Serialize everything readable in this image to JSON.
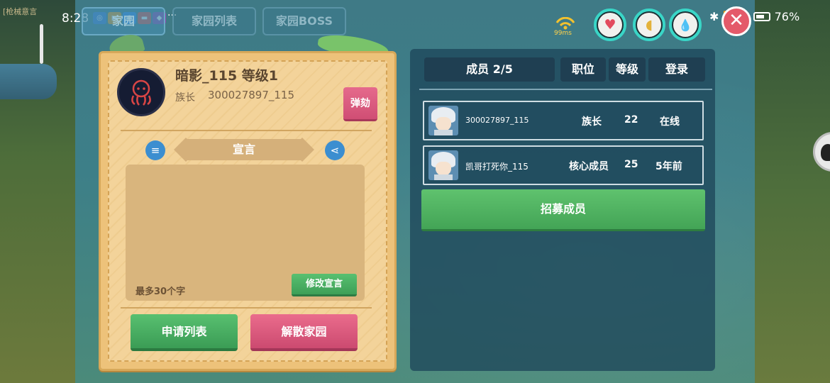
{
  "status_bar": {
    "time": "8:28",
    "more": "···",
    "battery": "76%"
  },
  "background": {
    "left_label": "[枪械意言"
  },
  "tabs": [
    {
      "label": "家园",
      "active": true
    },
    {
      "label": "家园列表",
      "active": false
    },
    {
      "label": "家园BOSS",
      "active": false
    }
  ],
  "hud": {
    "ping": "99ms",
    "gauges": [
      {
        "icon": "heart-icon",
        "glyph": "♥",
        "color": "#e24b5e",
        "ring": "#39d6c7"
      },
      {
        "icon": "stomach-icon",
        "glyph": "◖",
        "color": "#e3b23a",
        "ring": "#39d6c7"
      },
      {
        "icon": "water-drop-icon",
        "glyph": "💧",
        "color": "#2b9fc7",
        "ring": "#39d6c7"
      }
    ],
    "close": "✕"
  },
  "family": {
    "name": "暗影_115 等级1",
    "leader_label": "族长",
    "leader_id": "300027897_115",
    "impeach_label": "弹劾",
    "declaration_title": "宣言",
    "declaration_text": "",
    "declaration_hint": "最多30个字",
    "edit_declaration_label": "修改宣言",
    "apply_list_label": "申请列表",
    "disband_label": "解散家园"
  },
  "members": {
    "header": {
      "count": "成员 2/5",
      "position": "职位",
      "level": "等级",
      "login": "登录"
    },
    "rows": [
      {
        "name": "300027897_115",
        "role": "族长",
        "level": "22",
        "login": "在线"
      },
      {
        "name": "凯哥打死你_115",
        "role": "核心成员",
        "level": "25",
        "login": "5年前"
      }
    ],
    "recruit_label": "招募成员"
  },
  "colors": {
    "accent_green": "#4caf5f",
    "accent_pink": "#d9557a",
    "card": "#edc27a",
    "panel": "#1f3f52"
  }
}
